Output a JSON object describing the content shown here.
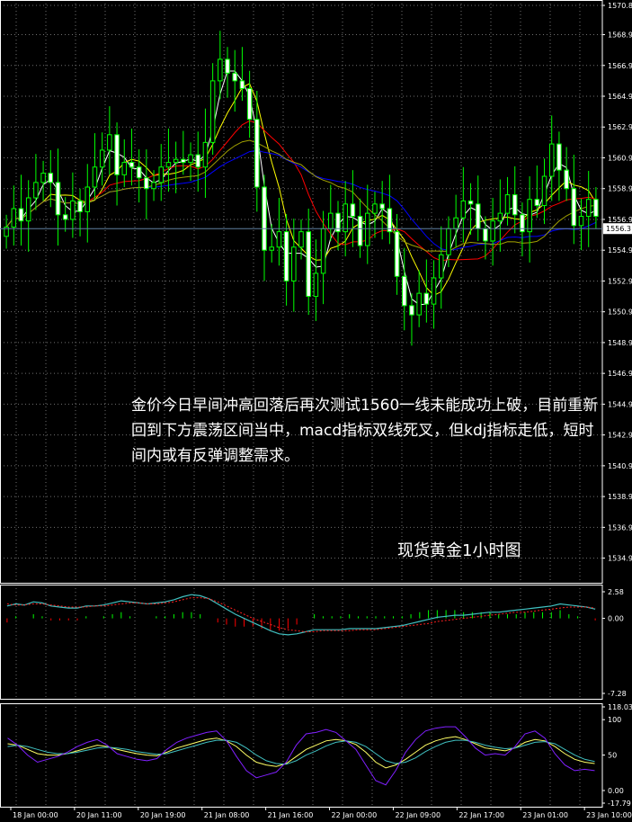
{
  "commentary": "金价今日早间冲高回落后再次测试1560一线未能成功上破，目前重新回到下方震荡区间当中，macd指标双线死叉，但kdj指标走低，短时间内或有反弹调整需求。",
  "chart_label": "现货黄金1小时图",
  "colors": {
    "background": "#000000",
    "bull": "#00ff00",
    "bear": "#ffffff",
    "ma_fast": "#ffffff",
    "ma_mid": "#ffff00",
    "ma_slow": "#ff0000",
    "ma_long": "#0000ff",
    "ma_200": "#a0a000",
    "macd_line": "#40c0c0",
    "macd_signal": "#ff2020",
    "kdj_k": "#ffff66",
    "kdj_d": "#40c0c0",
    "kdj_j": "#8020ff",
    "current_price_line": "#6080a0"
  },
  "chart_data": [
    {
      "type": "candlestick",
      "panel": "price",
      "ylim": [
        1534.0,
        1570.8
      ],
      "y_ticks": [
        "1570.8",
        "1568.9",
        "1566.9",
        "1564.9",
        "1562.9",
        "1560.9",
        "1558.9",
        "1556.9",
        "1554.9",
        "1552.9",
        "1550.9",
        "1548.9",
        "1546.9",
        "1544.9",
        "1542.9",
        "1540.9",
        "1538.9",
        "1536.9",
        "1534.9"
      ],
      "x_ticks": [
        "18 Jan 00:00",
        "20 Jan 11:00",
        "20 Jan 19:00",
        "21 Jan 08:00",
        "21 Jan 16:00",
        "22 Jan 00:00",
        "22 Jan 09:00",
        "22 Jan 17:00",
        "23 Jan 01:00",
        "23 Jan 10:00"
      ],
      "current_price": "1556.3",
      "indicators": [
        "MA (white)",
        "MA (yellow)",
        "MA (red)",
        "MA (blue)",
        "MA (olive)"
      ],
      "close": [
        1556.4,
        1557.6,
        1556.8,
        1558.3,
        1559.3,
        1559.9,
        1559.3,
        1557.2,
        1556.9,
        1558.1,
        1557.4,
        1559.0,
        1560.3,
        1561.4,
        1562.4,
        1559.8,
        1560.6,
        1560.3,
        1559.6,
        1558.9,
        1559.3,
        1560.3,
        1560.6,
        1560.8,
        1560.6,
        1561.1,
        1560.3,
        1561.9,
        1565.9,
        1567.3,
        1566.4,
        1565.9,
        1565.4,
        1563.4,
        1559.0,
        1554.9,
        1555.1,
        1556.1,
        1552.9,
        1555.1,
        1556.1,
        1551.9,
        1553.4,
        1556.3,
        1557.3,
        1556.1,
        1557.9,
        1557.1,
        1555.2,
        1557.3,
        1557.9,
        1557.6,
        1556.1,
        1553.2,
        1551.3,
        1550.7,
        1552.1,
        1551.4,
        1553.1,
        1554.6,
        1556.3,
        1557.0,
        1558.1,
        1557.9,
        1556.3,
        1555.5,
        1556.8,
        1557.3,
        1558.5,
        1557.2,
        1556.1,
        1558.2,
        1557.8,
        1559.7,
        1561.8,
        1560.1,
        1558.9,
        1556.5,
        1557.1,
        1558.2,
        1557.1
      ]
    },
    {
      "type": "line",
      "panel": "macd",
      "ylim": [
        -7.28,
        2.58
      ],
      "y_ticks": [
        "2.58",
        "0.00",
        "-7.28"
      ],
      "series": [
        {
          "name": "MACD",
          "values": [
            1.2,
            1.4,
            1.3,
            1.6,
            1.5,
            1.2,
            1.1,
            1.0,
            1.0,
            1.2,
            1.2,
            1.3,
            1.5,
            1.7,
            1.6,
            1.5,
            1.4,
            1.5,
            1.6,
            1.8,
            2.1,
            2.3,
            2.2,
            1.9,
            1.4,
            0.9,
            0.4,
            0.0,
            -0.4,
            -0.8,
            -1.2,
            -1.5,
            -1.6,
            -1.5,
            -1.3,
            -1.1,
            -1.1,
            -1.1,
            -1.1,
            -1.0,
            -1.0,
            -1.0,
            -1.0,
            -0.9,
            -0.8,
            -0.7,
            -0.5,
            -0.3,
            -0.1,
            0.1,
            0.2,
            0.3,
            0.3,
            0.4,
            0.5,
            0.6,
            0.6,
            0.7,
            0.8,
            0.9,
            1.0,
            1.1,
            1.2,
            1.4,
            1.3,
            1.2,
            1.1,
            0.9
          ]
        },
        {
          "name": "Signal",
          "values": [
            1.4,
            1.3,
            1.3,
            1.4,
            1.4,
            1.3,
            1.2,
            1.1,
            1.1,
            1.1,
            1.2,
            1.2,
            1.3,
            1.4,
            1.5,
            1.5,
            1.4,
            1.4,
            1.5,
            1.6,
            1.8,
            2.0,
            2.0,
            1.9,
            1.6,
            1.2,
            0.8,
            0.4,
            0.0,
            -0.3,
            -0.6,
            -0.9,
            -1.1,
            -1.2,
            -1.3,
            -1.3,
            -1.2,
            -1.2,
            -1.2,
            -1.2,
            -1.1,
            -1.1,
            -1.1,
            -1.0,
            -0.9,
            -0.8,
            -0.7,
            -0.6,
            -0.5,
            -0.3,
            -0.2,
            -0.1,
            0.0,
            0.1,
            0.2,
            0.3,
            0.4,
            0.5,
            0.6,
            0.6,
            0.7,
            0.8,
            0.9,
            1.0,
            1.1,
            1.1,
            1.1,
            1.0
          ]
        }
      ]
    },
    {
      "type": "line",
      "panel": "kdj",
      "ylim": [
        -17.79,
        118.03
      ],
      "y_ticks": [
        "118.03",
        "100",
        "50",
        "0.00",
        "-17.79"
      ],
      "series": [
        {
          "name": "K",
          "values": [
            66,
            64,
            58,
            52,
            50,
            50,
            52,
            56,
            60,
            64,
            62,
            58,
            55,
            52,
            50,
            49,
            54,
            60,
            64,
            68,
            72,
            74,
            70,
            62,
            50,
            40,
            36,
            34,
            38,
            48,
            58,
            64,
            70,
            72,
            70,
            65,
            54,
            40,
            32,
            36,
            44,
            54,
            64,
            70,
            74,
            76,
            72,
            66,
            60,
            58,
            56,
            60,
            68,
            72,
            70,
            62,
            52,
            44,
            40,
            38
          ]
        },
        {
          "name": "D",
          "values": [
            62,
            64,
            62,
            58,
            54,
            52,
            52,
            54,
            57,
            60,
            61,
            60,
            58,
            55,
            53,
            51,
            52,
            56,
            60,
            64,
            68,
            71,
            71,
            68,
            60,
            50,
            42,
            38,
            37,
            42,
            50,
            56,
            63,
            68,
            70,
            68,
            62,
            52,
            42,
            38,
            40,
            46,
            55,
            62,
            68,
            71,
            71,
            68,
            64,
            61,
            59,
            60,
            64,
            68,
            69,
            66,
            58,
            50,
            44,
            41
          ]
        },
        {
          "name": "J",
          "values": [
            74,
            64,
            50,
            40,
            44,
            48,
            54,
            62,
            68,
            72,
            64,
            52,
            48,
            44,
            42,
            45,
            58,
            68,
            74,
            78,
            82,
            84,
            70,
            48,
            28,
            18,
            22,
            26,
            40,
            64,
            80,
            82,
            86,
            82,
            70,
            58,
            36,
            14,
            8,
            28,
            54,
            72,
            84,
            88,
            90,
            90,
            76,
            60,
            50,
            52,
            50,
            62,
            80,
            84,
            74,
            52,
            36,
            28,
            30,
            28
          ]
        }
      ]
    }
  ]
}
